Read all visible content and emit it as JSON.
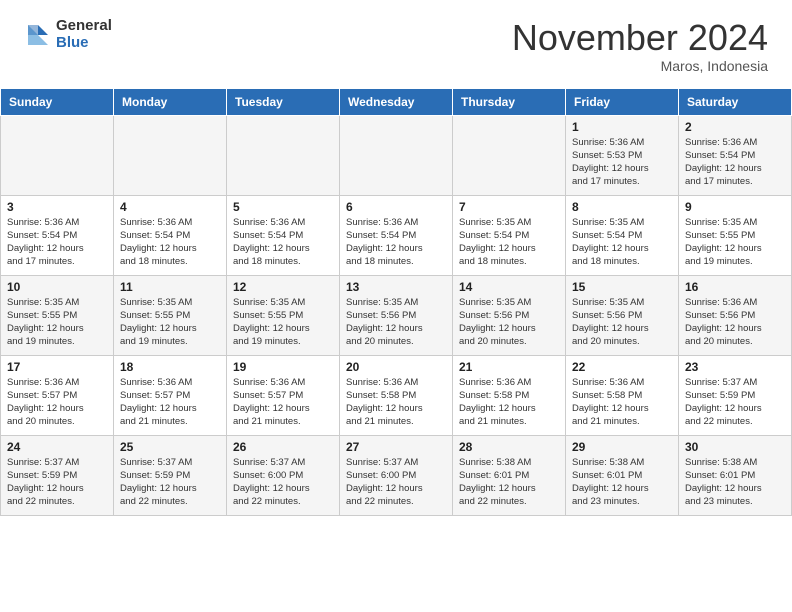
{
  "header": {
    "logo_general": "General",
    "logo_blue": "Blue",
    "month_title": "November 2024",
    "location": "Maros, Indonesia"
  },
  "weekdays": [
    "Sunday",
    "Monday",
    "Tuesday",
    "Wednesday",
    "Thursday",
    "Friday",
    "Saturday"
  ],
  "weeks": [
    [
      {
        "day": "",
        "info": ""
      },
      {
        "day": "",
        "info": ""
      },
      {
        "day": "",
        "info": ""
      },
      {
        "day": "",
        "info": ""
      },
      {
        "day": "",
        "info": ""
      },
      {
        "day": "1",
        "info": "Sunrise: 5:36 AM\nSunset: 5:53 PM\nDaylight: 12 hours\nand 17 minutes."
      },
      {
        "day": "2",
        "info": "Sunrise: 5:36 AM\nSunset: 5:54 PM\nDaylight: 12 hours\nand 17 minutes."
      }
    ],
    [
      {
        "day": "3",
        "info": "Sunrise: 5:36 AM\nSunset: 5:54 PM\nDaylight: 12 hours\nand 17 minutes."
      },
      {
        "day": "4",
        "info": "Sunrise: 5:36 AM\nSunset: 5:54 PM\nDaylight: 12 hours\nand 18 minutes."
      },
      {
        "day": "5",
        "info": "Sunrise: 5:36 AM\nSunset: 5:54 PM\nDaylight: 12 hours\nand 18 minutes."
      },
      {
        "day": "6",
        "info": "Sunrise: 5:36 AM\nSunset: 5:54 PM\nDaylight: 12 hours\nand 18 minutes."
      },
      {
        "day": "7",
        "info": "Sunrise: 5:35 AM\nSunset: 5:54 PM\nDaylight: 12 hours\nand 18 minutes."
      },
      {
        "day": "8",
        "info": "Sunrise: 5:35 AM\nSunset: 5:54 PM\nDaylight: 12 hours\nand 18 minutes."
      },
      {
        "day": "9",
        "info": "Sunrise: 5:35 AM\nSunset: 5:55 PM\nDaylight: 12 hours\nand 19 minutes."
      }
    ],
    [
      {
        "day": "10",
        "info": "Sunrise: 5:35 AM\nSunset: 5:55 PM\nDaylight: 12 hours\nand 19 minutes."
      },
      {
        "day": "11",
        "info": "Sunrise: 5:35 AM\nSunset: 5:55 PM\nDaylight: 12 hours\nand 19 minutes."
      },
      {
        "day": "12",
        "info": "Sunrise: 5:35 AM\nSunset: 5:55 PM\nDaylight: 12 hours\nand 19 minutes."
      },
      {
        "day": "13",
        "info": "Sunrise: 5:35 AM\nSunset: 5:56 PM\nDaylight: 12 hours\nand 20 minutes."
      },
      {
        "day": "14",
        "info": "Sunrise: 5:35 AM\nSunset: 5:56 PM\nDaylight: 12 hours\nand 20 minutes."
      },
      {
        "day": "15",
        "info": "Sunrise: 5:35 AM\nSunset: 5:56 PM\nDaylight: 12 hours\nand 20 minutes."
      },
      {
        "day": "16",
        "info": "Sunrise: 5:36 AM\nSunset: 5:56 PM\nDaylight: 12 hours\nand 20 minutes."
      }
    ],
    [
      {
        "day": "17",
        "info": "Sunrise: 5:36 AM\nSunset: 5:57 PM\nDaylight: 12 hours\nand 20 minutes."
      },
      {
        "day": "18",
        "info": "Sunrise: 5:36 AM\nSunset: 5:57 PM\nDaylight: 12 hours\nand 21 minutes."
      },
      {
        "day": "19",
        "info": "Sunrise: 5:36 AM\nSunset: 5:57 PM\nDaylight: 12 hours\nand 21 minutes."
      },
      {
        "day": "20",
        "info": "Sunrise: 5:36 AM\nSunset: 5:58 PM\nDaylight: 12 hours\nand 21 minutes."
      },
      {
        "day": "21",
        "info": "Sunrise: 5:36 AM\nSunset: 5:58 PM\nDaylight: 12 hours\nand 21 minutes."
      },
      {
        "day": "22",
        "info": "Sunrise: 5:36 AM\nSunset: 5:58 PM\nDaylight: 12 hours\nand 21 minutes."
      },
      {
        "day": "23",
        "info": "Sunrise: 5:37 AM\nSunset: 5:59 PM\nDaylight: 12 hours\nand 22 minutes."
      }
    ],
    [
      {
        "day": "24",
        "info": "Sunrise: 5:37 AM\nSunset: 5:59 PM\nDaylight: 12 hours\nand 22 minutes."
      },
      {
        "day": "25",
        "info": "Sunrise: 5:37 AM\nSunset: 5:59 PM\nDaylight: 12 hours\nand 22 minutes."
      },
      {
        "day": "26",
        "info": "Sunrise: 5:37 AM\nSunset: 6:00 PM\nDaylight: 12 hours\nand 22 minutes."
      },
      {
        "day": "27",
        "info": "Sunrise: 5:37 AM\nSunset: 6:00 PM\nDaylight: 12 hours\nand 22 minutes."
      },
      {
        "day": "28",
        "info": "Sunrise: 5:38 AM\nSunset: 6:01 PM\nDaylight: 12 hours\nand 22 minutes."
      },
      {
        "day": "29",
        "info": "Sunrise: 5:38 AM\nSunset: 6:01 PM\nDaylight: 12 hours\nand 23 minutes."
      },
      {
        "day": "30",
        "info": "Sunrise: 5:38 AM\nSunset: 6:01 PM\nDaylight: 12 hours\nand 23 minutes."
      }
    ]
  ]
}
